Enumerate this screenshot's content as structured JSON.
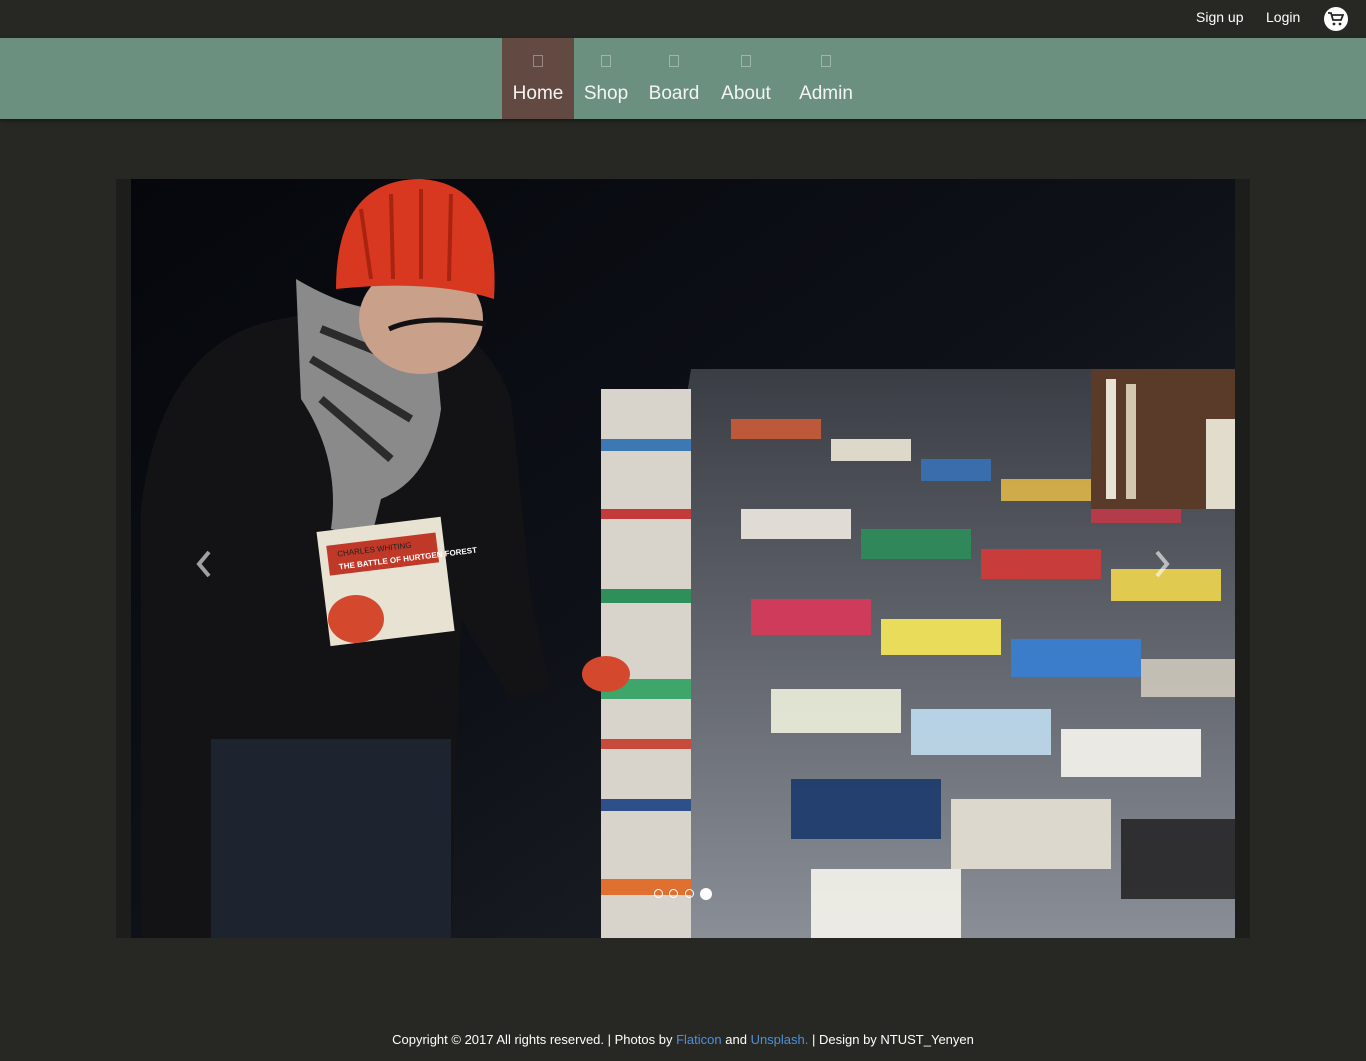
{
  "topbar": {
    "signup_label": "Sign up",
    "login_label": "Login",
    "cart_icon": "cart-icon"
  },
  "nav": {
    "items": [
      {
        "label": "Home",
        "icon": "home-icon",
        "active": true
      },
      {
        "label": "Shop",
        "icon": "shop-icon",
        "active": false
      },
      {
        "label": "Board",
        "icon": "board-icon",
        "active": false
      },
      {
        "label": "About",
        "icon": "about-icon",
        "active": false
      },
      {
        "label": "Admin",
        "icon": "admin-icon",
        "active": false
      }
    ],
    "active_color": "#624a43",
    "bar_color": "#6b9080"
  },
  "carousel": {
    "slide_count": 4,
    "active_slide": 4,
    "prev_icon": "chevron-left-icon",
    "next_icon": "chevron-right-icon",
    "book_cover_title": "THE BATTLE OF HURTGEN FOREST",
    "book_cover_author": "CHARLES WHITING"
  },
  "footer": {
    "copyright": "Copyright © 2017 All rights reserved. | Photos by",
    "flaticon_link": "Flaticon",
    "and_text": "and",
    "unsplash_link": "Unsplash.",
    "design_text": "| Design by NTUST_Yenyen",
    "link_color": "#4f8fd8"
  },
  "colors": {
    "background": "#272824"
  }
}
